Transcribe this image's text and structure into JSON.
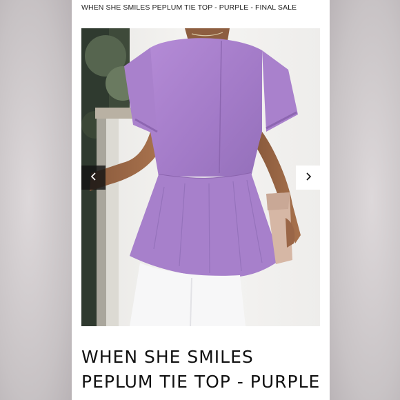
{
  "breadcrumb": {
    "text": "WHEN SHE SMILES PEPLUM TIE TOP - PURPLE - FINAL SALE"
  },
  "gallery": {
    "image_subject": "purple-peplum-tie-top-back-view",
    "prev_icon": "chevron-left-icon",
    "next_icon": "chevron-right-icon"
  },
  "product": {
    "title_line1": "WHEN SHE SMILES",
    "title_line2": "PEPLUM TIE TOP - PURPLE"
  },
  "colors": {
    "top_purple": "#a77fcb",
    "background_wall": "#f4f3f1",
    "jeans_white": "#f7f7f8",
    "clutch": "#d6b7a5"
  }
}
